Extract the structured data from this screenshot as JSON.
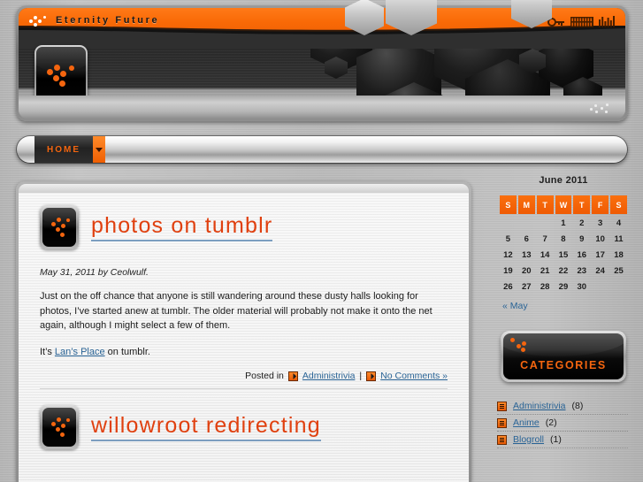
{
  "site": {
    "title": "Eternity Future",
    "logo_icon": "orange-dots-logo-icon",
    "header_icons": [
      "key-search-icon",
      "grid-barcode-icon",
      "equalizer-bars-icon"
    ]
  },
  "nav": {
    "items": [
      {
        "label": "HOME",
        "has_dropdown": true,
        "caret_icon": "chevron-down-icon"
      }
    ]
  },
  "posts": [
    {
      "title": "photos on tumblr",
      "icon": "post-badge-icon",
      "byline": "May 31, 2011 by Ceolwulf.",
      "paragraph1_before": "Just on the off chance that anyone is still wandering around these dusty halls looking for photos, I’ve started anew at tumblr.  The older material will probably not make it onto the net again, although I might select a few of them.",
      "paragraph2_before": "It’s ",
      "paragraph2_link": "Lan’s Place",
      "paragraph2_after": " on tumblr.",
      "meta": {
        "posted_in_label": "Posted in",
        "category_icon": "orange-arrow-icon",
        "category": "Administrivia",
        "separator": "|",
        "comments_icon": "orange-arrow-icon",
        "comments": "No Comments »"
      }
    },
    {
      "title": "willowroot redirecting",
      "icon": "post-badge-icon"
    }
  ],
  "sidebar": {
    "calendar": {
      "title": "June 2011",
      "weekday_headers": [
        "S",
        "M",
        "T",
        "W",
        "T",
        "F",
        "S"
      ],
      "weeks": [
        [
          "",
          "",
          "",
          "1",
          "2",
          "3",
          "4"
        ],
        [
          "5",
          "6",
          "7",
          "8",
          "9",
          "10",
          "11"
        ],
        [
          "12",
          "13",
          "14",
          "15",
          "16",
          "17",
          "18"
        ],
        [
          "19",
          "20",
          "21",
          "22",
          "23",
          "24",
          "25"
        ],
        [
          "26",
          "27",
          "28",
          "29",
          "30",
          "",
          ""
        ]
      ],
      "prev_link": "« May"
    },
    "categories": {
      "header_label": "CATEGORIES",
      "header_icon": "orange-dots-logo-icon",
      "items": [
        {
          "bullet_icon": "orange-list-icon",
          "label": "Administrivia",
          "count": "(8)"
        },
        {
          "bullet_icon": "orange-list-icon",
          "label": "Anime",
          "count": "(2)"
        },
        {
          "bullet_icon": "orange-list-icon",
          "label": "Blogroll",
          "count": "(1)"
        }
      ]
    }
  },
  "colors": {
    "accent_orange": "#f4650f",
    "title_orange": "#e0400f",
    "link_blue": "#2a6496",
    "underline_blue": "#7c9ec0",
    "dark_panel": "#101010"
  }
}
